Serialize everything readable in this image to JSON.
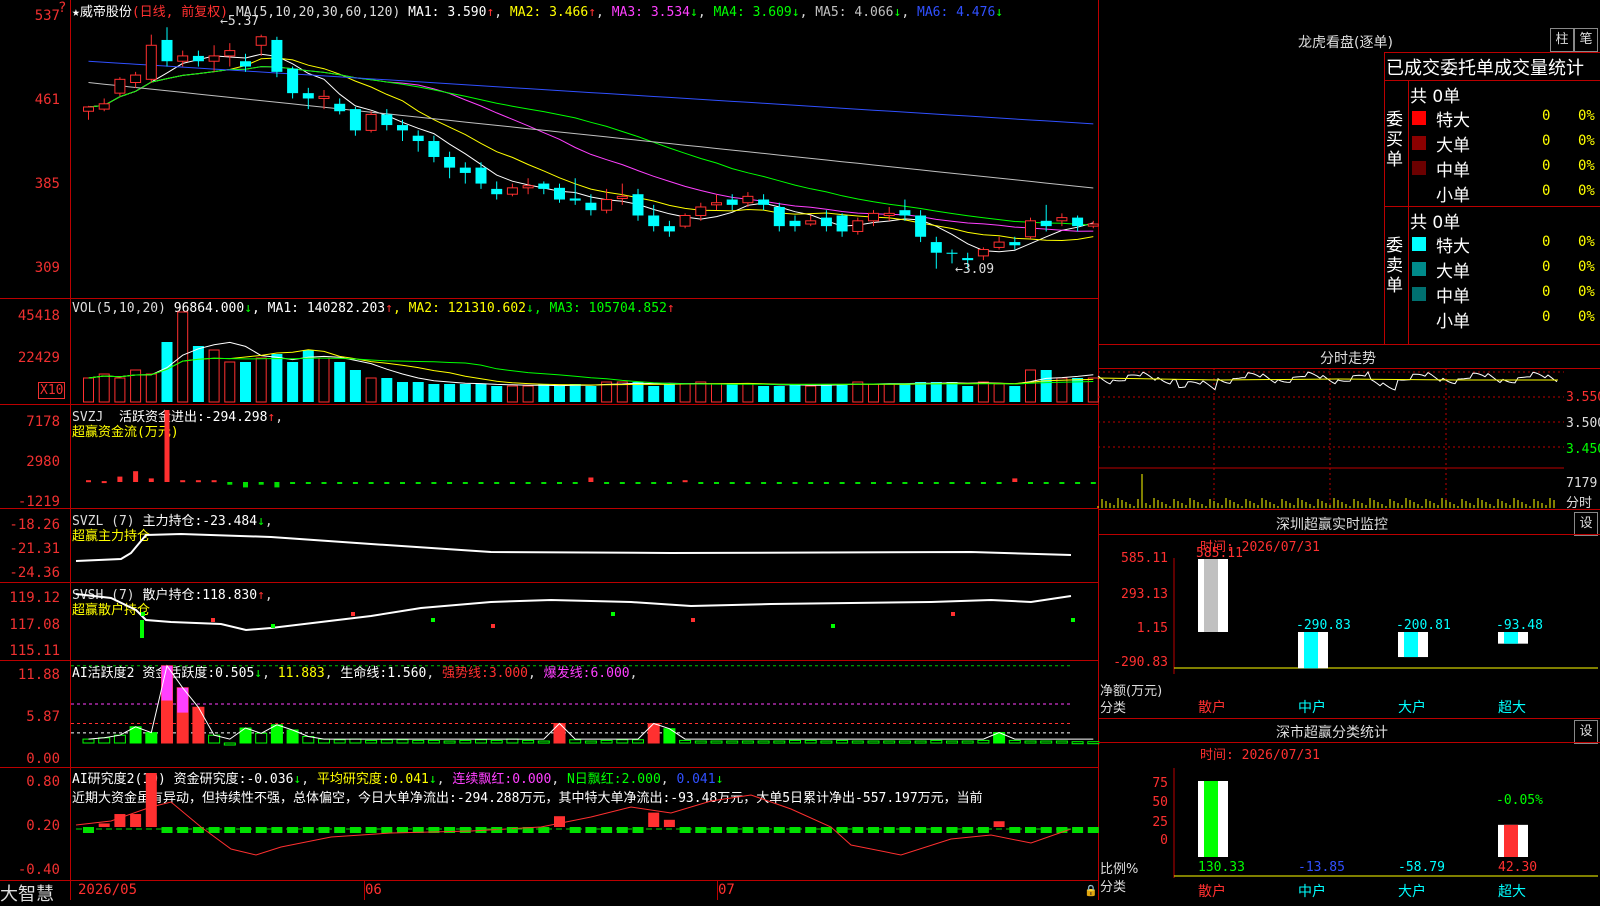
{
  "app": {
    "brand": "大智慧"
  },
  "colors": {
    "up": "#ff3030",
    "down": "#00ffff",
    "grid": "#b00000",
    "ma1": "#ffffff",
    "ma2": "#ffff00",
    "ma3": "#ff40ff",
    "ma4": "#00ff00",
    "ma5": "#c0c0c0",
    "ma6": "#3050ff"
  },
  "main": {
    "title": "★威帝股份",
    "period": "(日线, 前复权)",
    "ma_label": "MA(5,10,20,30,60,120)",
    "ma": [
      {
        "k": "MA1:",
        "v": "3.590",
        "arrow": "↑",
        "color": "#ffffff"
      },
      {
        "k": "MA2:",
        "v": "3.466",
        "arrow": "↑",
        "color": "#ffff00"
      },
      {
        "k": "MA3:",
        "v": "3.534",
        "arrow": "↓",
        "color": "#ff40ff"
      },
      {
        "k": "MA4:",
        "v": "3.609",
        "arrow": "↓",
        "color": "#00ff00"
      },
      {
        "k": "MA5:",
        "v": "4.066",
        "arrow": "↓",
        "color": "#c0c0c0"
      },
      {
        "k": "MA6:",
        "v": "4.476",
        "arrow": "↓",
        "color": "#3050ff"
      }
    ],
    "axis": [
      "537",
      "461",
      "385",
      "309"
    ],
    "high_label": "5.37",
    "low_label": "3.09",
    "question": "?"
  },
  "vol": {
    "label": "VOL(5,10,20)",
    "value": "96864.000",
    "arrow": "↓",
    "ma": [
      {
        "k": "MA1:",
        "v": "140282.203",
        "arrow": "↑",
        "color": "#ffffff"
      },
      {
        "k": "MA2:",
        "v": "121310.602",
        "arrow": "↓",
        "color": "#ffff00"
      },
      {
        "k": "MA3:",
        "v": "105704.852",
        "arrow": "↑",
        "color": "#00ff00"
      }
    ],
    "axis": [
      "45418",
      "22429"
    ],
    "unit": "X10"
  },
  "svzj": {
    "label": "SVZJ",
    "name": "活跃资金进出:",
    "value": "-294.298",
    "arrow": "↑",
    "title": "超赢资金流(万元)",
    "axis": [
      "7178",
      "2980",
      "-1219"
    ]
  },
  "svzl": {
    "label": "SVZL (7)",
    "name": "主力持仓:",
    "value": "-23.484",
    "arrow": "↓",
    "title": "超赢主力持仓",
    "axis": [
      "-18.26",
      "-21.31",
      "-24.36"
    ]
  },
  "svsh": {
    "label": "SVSH (7)",
    "name": "散户持仓:",
    "value": "118.830",
    "arrow": "↑",
    "title": "超赢散户持仓",
    "axis": [
      "119.12",
      "117.08",
      "115.11"
    ]
  },
  "ai1": {
    "label": "AI活跃度2",
    "k1": "资金活跃度:",
    "v1": "0.505",
    "a1": "↓",
    "v2": "11.883",
    "k3": "生命线:",
    "v3": "1.560",
    "k4": "强势线:",
    "v4": "3.000",
    "k5": "爆发线:",
    "v5": "6.000",
    "axis": [
      "11.88",
      "5.87",
      "0.00"
    ]
  },
  "ai2": {
    "label": "AI研究度2(10)",
    "k1": "资金研究度:",
    "v1": "-0.036",
    "a1": "↓",
    "k2": "平均研究度:",
    "v2": "0.041",
    "a2": "↓",
    "k3": "连续飘红:",
    "v3": "0.000",
    "k4": "N日飘红:",
    "v4": "2.000",
    "v5": "0.041",
    "a5": "↓",
    "text": "近期大资金虽有异动，但持续性不强，总体偏空，今日大单净流出:-294.288万元，其中特大单净流出:-93.48万元，大单5日累计净出-557.197万元，当前",
    "axis": [
      "0.80",
      "0.20",
      "-0.40"
    ]
  },
  "dates": [
    "2026/05",
    "06",
    "07"
  ],
  "right": {
    "lhb_title": "龙虎看盘(逐单)",
    "btn1": "柱",
    "btn2": "笔",
    "stats_title": "已成交委托单成交量统计",
    "buy_side": "委买单",
    "sell_side": "委卖单",
    "buy_total": "共 0单",
    "sell_total": "共 0单",
    "buy_rows": [
      {
        "name": "特大",
        "n": "0",
        "p": "0%",
        "color": "#ff0000"
      },
      {
        "name": "大单",
        "n": "0",
        "p": "0%",
        "color": "#8b0000"
      },
      {
        "name": "中单",
        "n": "0",
        "p": "0%",
        "color": "#6b0000"
      },
      {
        "name": "小单",
        "n": "0",
        "p": "0%",
        "color": ""
      }
    ],
    "sell_rows": [
      {
        "name": "特大",
        "n": "0",
        "p": "0%",
        "color": "#00ffff"
      },
      {
        "name": "大单",
        "n": "0",
        "p": "0%",
        "color": "#008b8b"
      },
      {
        "name": "中单",
        "n": "0",
        "p": "0%",
        "color": "#007070"
      },
      {
        "name": "小单",
        "n": "0",
        "p": "0%",
        "color": ""
      }
    ],
    "fs_title": "分时走势",
    "fs_axis": [
      "3.550",
      "3.500",
      "3.450"
    ],
    "fs_vol": "7179",
    "fs_vol_label": "分时",
    "sz_title": "深圳超赢实时监控",
    "set1": "设",
    "sz_time": "时间: 2026/07/31",
    "sz_axis": [
      "585.11",
      "293.13",
      "1.15",
      "-290.83"
    ],
    "sz_ylabel1": "净额(万元)",
    "sz_ylabel2": "分类",
    "sz_bars": [
      {
        "name": "散户",
        "value": "585.11",
        "color": "#c0c0c0"
      },
      {
        "name": "中户",
        "value": "-290.83",
        "color": "#00ffff"
      },
      {
        "name": "大户",
        "value": "-200.81",
        "color": "#00ffff"
      },
      {
        "name": "超大",
        "value": "-93.48",
        "color": "#00ffff"
      }
    ],
    "sh_title": "深市超赢分类统计",
    "set2": "设",
    "sh_time": "时间: 2026/07/31",
    "sh_axis": [
      "75",
      "50",
      "25",
      "0"
    ],
    "sh_ylabel1": "比例%",
    "sh_ylabel2": "分类",
    "sh_pct": "-0.05%",
    "sh_bars": [
      {
        "name": "散户",
        "value": "130.33",
        "color": "#00ff00"
      },
      {
        "name": "中户",
        "value": "-13.85",
        "color": "#3050ff"
      },
      {
        "name": "大户",
        "value": "-58.79",
        "color": "#00ffff"
      },
      {
        "name": "超大",
        "value": "42.30",
        "color": "#ff3030"
      }
    ]
  },
  "chart_data": {
    "type": "candlestick",
    "ylim": [
      3.05,
      5.4
    ],
    "candles": [
      [
        4.58,
        4.62,
        4.5,
        4.63
      ],
      [
        4.6,
        4.65,
        4.58,
        4.7
      ],
      [
        4.75,
        4.88,
        4.72,
        4.9
      ],
      [
        4.85,
        4.92,
        4.8,
        4.95
      ],
      [
        4.88,
        5.2,
        4.85,
        5.3
      ],
      [
        5.25,
        5.05,
        5.0,
        5.37
      ],
      [
        5.05,
        5.1,
        5.0,
        5.15
      ],
      [
        5.1,
        5.05,
        5.0,
        5.15
      ],
      [
        5.05,
        5.1,
        4.95,
        5.2
      ],
      [
        5.1,
        5.15,
        5.0,
        5.22
      ],
      [
        5.05,
        5.0,
        4.95,
        5.12
      ],
      [
        5.2,
        5.28,
        5.1,
        5.3
      ],
      [
        5.25,
        4.95,
        4.9,
        5.28
      ],
      [
        4.98,
        4.75,
        4.7,
        5.0
      ],
      [
        4.75,
        4.7,
        4.6,
        4.8
      ],
      [
        4.7,
        4.72,
        4.6,
        4.78
      ],
      [
        4.65,
        4.58,
        4.55,
        4.7
      ],
      [
        4.6,
        4.4,
        4.35,
        4.62
      ],
      [
        4.4,
        4.55,
        4.38,
        4.58
      ],
      [
        4.55,
        4.45,
        4.4,
        4.6
      ],
      [
        4.45,
        4.4,
        4.3,
        4.5
      ],
      [
        4.35,
        4.3,
        4.2,
        4.4
      ],
      [
        4.3,
        4.15,
        4.1,
        4.35
      ],
      [
        4.15,
        4.05,
        3.95,
        4.2
      ],
      [
        4.05,
        4.0,
        3.9,
        4.1
      ],
      [
        4.05,
        3.9,
        3.85,
        4.1
      ],
      [
        3.85,
        3.8,
        3.75,
        3.92
      ],
      [
        3.8,
        3.86,
        3.78,
        3.9
      ],
      [
        3.86,
        3.88,
        3.8,
        3.95
      ],
      [
        3.9,
        3.85,
        3.8,
        3.92
      ],
      [
        3.86,
        3.75,
        3.72,
        3.9
      ],
      [
        3.76,
        3.74,
        3.7,
        3.95
      ],
      [
        3.72,
        3.65,
        3.6,
        3.8
      ],
      [
        3.65,
        3.75,
        3.62,
        3.85
      ],
      [
        3.76,
        3.78,
        3.7,
        3.9
      ],
      [
        3.8,
        3.6,
        3.55,
        3.85
      ],
      [
        3.6,
        3.5,
        3.45,
        3.7
      ],
      [
        3.5,
        3.45,
        3.4,
        3.55
      ],
      [
        3.5,
        3.6,
        3.48,
        3.62
      ],
      [
        3.6,
        3.68,
        3.55,
        3.72
      ],
      [
        3.7,
        3.72,
        3.65,
        3.8
      ],
      [
        3.75,
        3.7,
        3.65,
        3.8
      ],
      [
        3.72,
        3.78,
        3.68,
        3.82
      ],
      [
        3.75,
        3.7,
        3.65,
        3.8
      ],
      [
        3.68,
        3.5,
        3.45,
        3.72
      ],
      [
        3.55,
        3.5,
        3.45,
        3.6
      ],
      [
        3.52,
        3.55,
        3.5,
        3.6
      ],
      [
        3.58,
        3.5,
        3.45,
        3.65
      ],
      [
        3.6,
        3.45,
        3.4,
        3.62
      ],
      [
        3.45,
        3.55,
        3.42,
        3.58
      ],
      [
        3.55,
        3.62,
        3.5,
        3.65
      ],
      [
        3.6,
        3.62,
        3.55,
        3.68
      ],
      [
        3.65,
        3.6,
        3.55,
        3.75
      ],
      [
        3.6,
        3.4,
        3.35,
        3.65
      ],
      [
        3.35,
        3.25,
        3.1,
        3.4
      ],
      [
        3.25,
        3.24,
        3.15,
        3.28
      ],
      [
        3.2,
        3.18,
        3.09,
        3.25
      ],
      [
        3.22,
        3.28,
        3.18,
        3.3
      ],
      [
        3.3,
        3.35,
        3.28,
        3.4
      ],
      [
        3.35,
        3.32,
        3.28,
        3.4
      ],
      [
        3.4,
        3.55,
        3.38,
        3.58
      ],
      [
        3.55,
        3.5,
        3.45,
        3.7
      ],
      [
        3.55,
        3.58,
        3.5,
        3.62
      ],
      [
        3.58,
        3.5,
        3.45,
        3.6
      ],
      [
        3.5,
        3.52,
        3.48,
        3.55
      ]
    ],
    "volumes": [
      12,
      14,
      12,
      16,
      14,
      30,
      45,
      28,
      26,
      20,
      20,
      22,
      24,
      20,
      26,
      22,
      20,
      16,
      12,
      12,
      10,
      10,
      9,
      9,
      9,
      9,
      8,
      8,
      8,
      9,
      8,
      9,
      8,
      10,
      10,
      10,
      8,
      9,
      9,
      10,
      9,
      9,
      9,
      8,
      8,
      9,
      8,
      9,
      9,
      10,
      9,
      9,
      9,
      10,
      10,
      10,
      8,
      10,
      9,
      8,
      16,
      16,
      12,
      12,
      12
    ],
    "svzj": [
      0.2,
      0.1,
      0.6,
      1.2,
      0.4,
      8,
      0.2,
      0.2,
      0.2,
      -0.3,
      -0.6,
      -0.3,
      -0.6,
      -0.2,
      -0.2,
      -0.2,
      -0.2,
      -0.2,
      -0.2,
      -0.2,
      -0.2,
      -0.2,
      -0.2,
      -0.2,
      -0.2,
      -0.2,
      -0.2,
      -0.2,
      -0.2,
      -0.2,
      -0.2,
      -0.2,
      0.5,
      -0.2,
      -0.2,
      -0.2,
      -0.2,
      -0.2,
      0.2,
      -0.2,
      -0.2,
      -0.2,
      -0.2,
      -0.2,
      -0.2,
      -0.2,
      -0.2,
      -0.2,
      -0.2,
      -0.2,
      -0.2,
      -0.2,
      -0.2,
      -0.2,
      -0.2,
      -0.2,
      -0.2,
      -0.2,
      -0.2,
      0.4,
      -0.2,
      -0.2,
      -0.2,
      -0.2,
      -0.2
    ],
    "ai1": [
      0.6,
      0.8,
      1.2,
      2.5,
      1.6,
      11.88,
      8.5,
      5.5,
      1.2,
      0,
      2.3,
      1.5,
      2.8,
      2.0,
      1.0,
      0.6,
      0.5,
      0.6,
      0.4,
      0.5,
      0.5,
      0.4,
      0.4,
      0.3,
      0.4,
      0.5,
      0.4,
      0.6,
      0.4,
      0.3,
      3.0,
      0.5,
      0.3,
      0.4,
      0.5,
      0.5,
      3.0,
      2.2,
      0.4,
      0.3,
      0.3,
      0.3,
      0.3,
      0.3,
      0.3,
      0.4,
      0.4,
      0.3,
      0.4,
      0.3,
      0.3,
      0.3,
      0.3,
      0.3,
      0.4,
      0.3,
      0.3,
      0.4,
      1.6,
      0.4,
      0.3,
      0.3,
      0.3,
      0.2,
      0.2
    ],
    "ai2": [
      -0.05,
      0.05,
      0.18,
      0.18,
      0.75,
      -0.05,
      -0.05,
      -0.05,
      -0.05,
      -0.05,
      -0.05,
      -0.05,
      -0.05,
      -0.05,
      -0.05,
      -0.05,
      -0.05,
      -0.05,
      -0.05,
      -0.05,
      -0.05,
      -0.05,
      -0.05,
      -0.05,
      -0.05,
      -0.05,
      -0.05,
      -0.05,
      -0.05,
      -0.05,
      0.15,
      -0.05,
      -0.05,
      -0.05,
      -0.05,
      -0.05,
      0.2,
      0.1,
      -0.05,
      -0.05,
      -0.05,
      -0.05,
      -0.05,
      -0.05,
      -0.05,
      -0.05,
      -0.05,
      -0.05,
      -0.05,
      -0.05,
      -0.05,
      -0.05,
      -0.05,
      -0.05,
      -0.05,
      -0.05,
      -0.05,
      -0.05,
      0.08,
      -0.05,
      -0.05,
      -0.05,
      -0.05,
      -0.05,
      -0.05
    ]
  }
}
